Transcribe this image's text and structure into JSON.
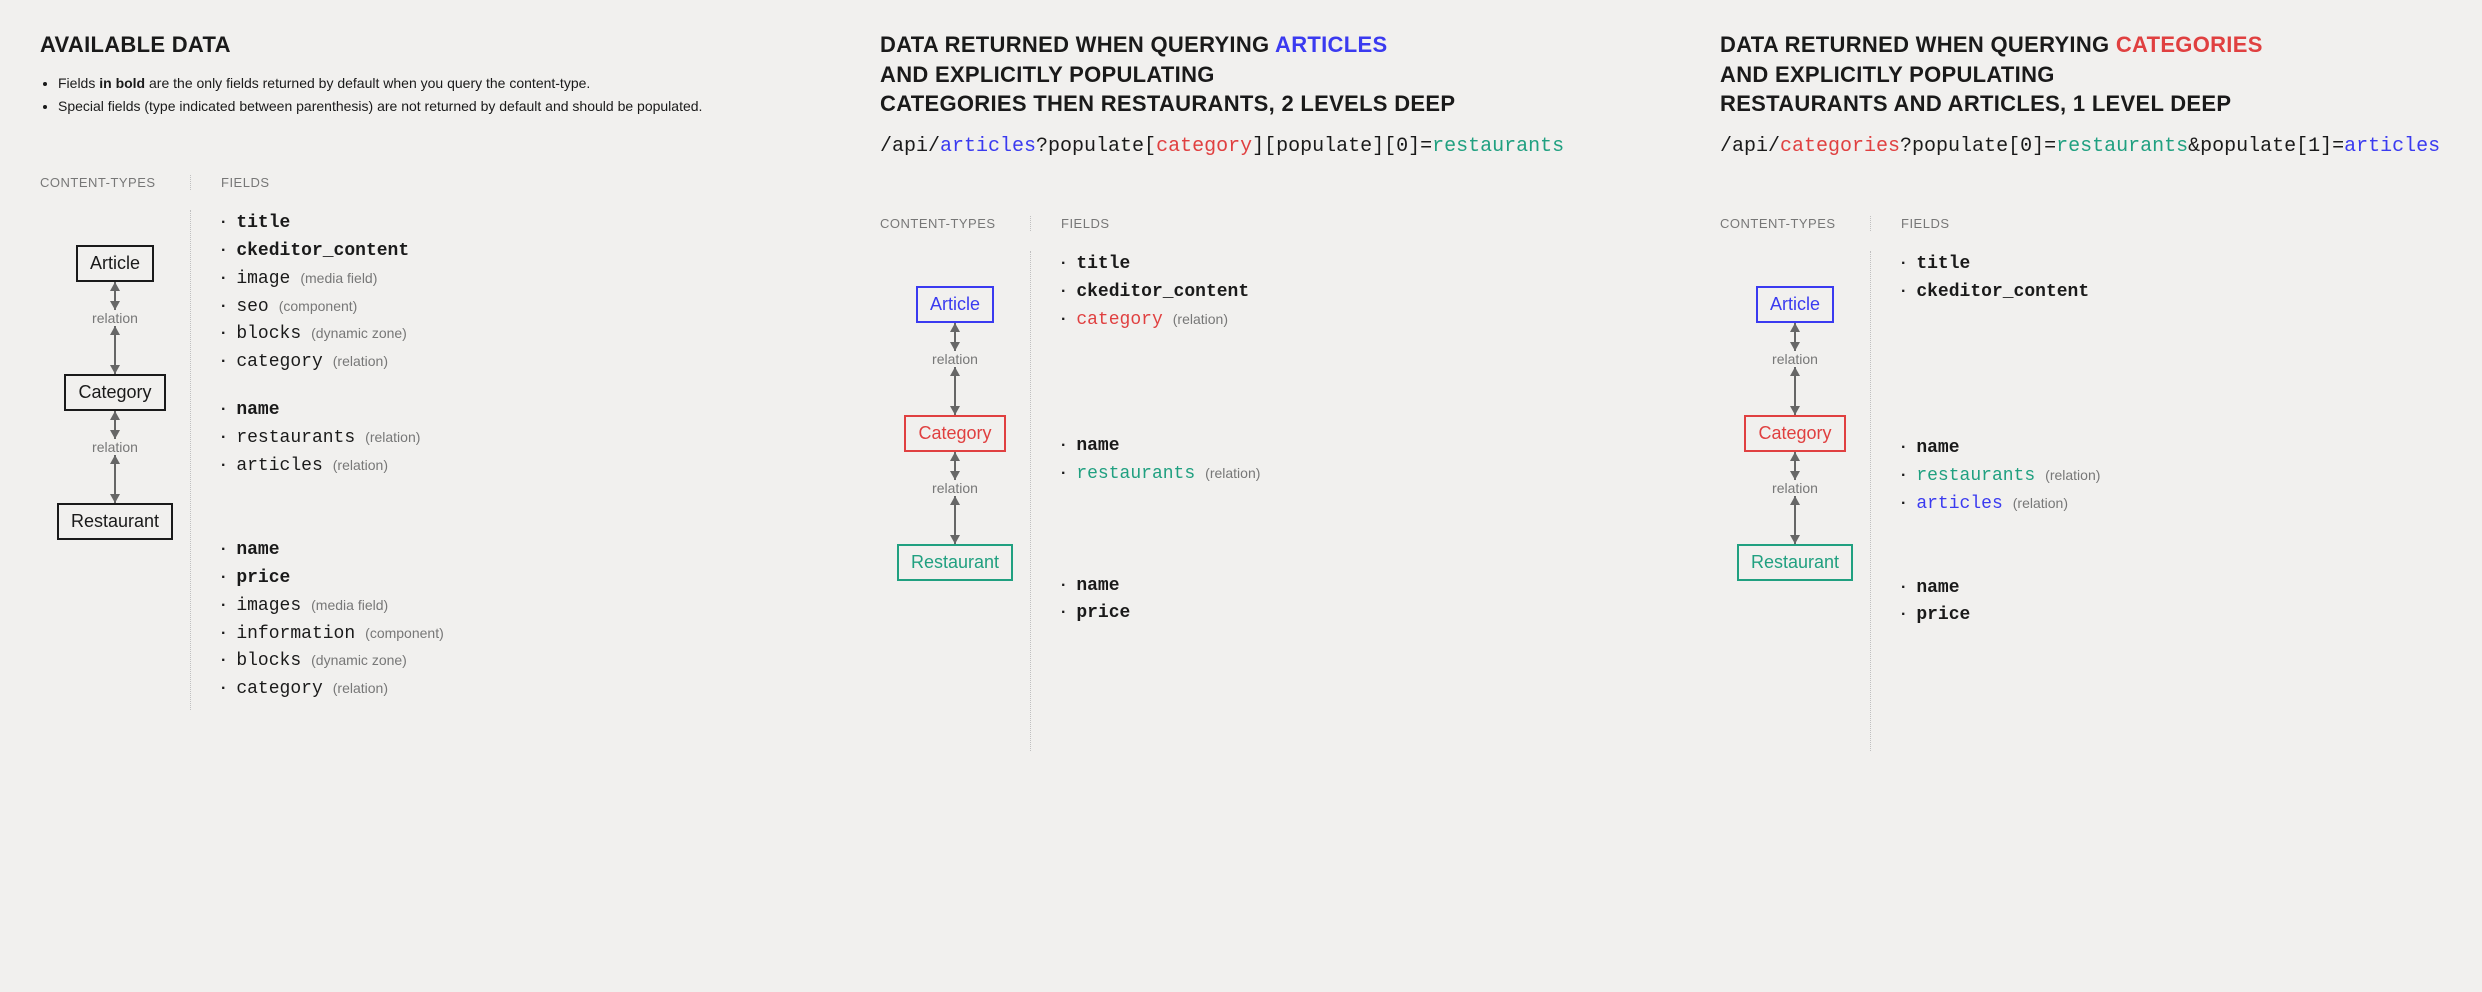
{
  "col1": {
    "title": "AVAILABLE DATA",
    "desc_part1": "Fields ",
    "desc_bold": "in bold",
    "desc_part2": " are the only fields returned by default when you query the content-type.",
    "desc_line2": "Special fields (type indicated between parenthesis) are not returned by default and should be populated.",
    "head_left": "CONTENT-TYPES",
    "head_right": "FIELDS",
    "box_article": "Article",
    "box_category": "Category",
    "box_restaurant": "Restaurant",
    "relation_label": "relation",
    "article_fields": {
      "title": "title",
      "cke": "ckeditor_content",
      "image": "image",
      "image_type": "(media field)",
      "seo": "seo",
      "seo_type": "(component)",
      "blocks": "blocks",
      "blocks_type": "(dynamic zone)",
      "category": "category",
      "category_type": "(relation)"
    },
    "category_fields": {
      "name": "name",
      "restaurants": "restaurants",
      "restaurants_type": "(relation)",
      "articles": "articles",
      "articles_type": "(relation)"
    },
    "restaurant_fields": {
      "name": "name",
      "price": "price",
      "images": "images",
      "images_type": "(media field)",
      "information": "information",
      "information_type": "(component)",
      "blocks": "blocks",
      "blocks_type": "(dynamic zone)",
      "category": "category",
      "category_type": "(relation)"
    }
  },
  "col2": {
    "title_pre": "DATA RETURNED WHEN QUERYING ",
    "title_hi": "ARTICLES",
    "title_line2": "AND EXPLICITLY POPULATING",
    "title_line3": "CATEGORIES THEN RESTAURANTS, 2 LEVELS DEEP",
    "api_p1": "/api/",
    "api_p2": "articles",
    "api_p3": "?populate[",
    "api_p4": "category",
    "api_p5": "][populate][0]=",
    "api_p6": "restaurants",
    "head_left": "CONTENT-TYPES",
    "head_right": "FIELDS",
    "box_article": "Article",
    "box_category": "Category",
    "box_restaurant": "Restaurant",
    "relation_label": "relation",
    "article_fields": {
      "title": "title",
      "cke": "ckeditor_content",
      "category": "category",
      "category_type": "(relation)"
    },
    "category_fields": {
      "name": "name",
      "restaurants": "restaurants",
      "restaurants_type": "(relation)"
    },
    "restaurant_fields": {
      "name": "name",
      "price": "price"
    }
  },
  "col3": {
    "title_pre": "DATA RETURNED WHEN QUERYING ",
    "title_hi": "CATEGORIES",
    "title_line2": "AND EXPLICITLY POPULATING",
    "title_line3": "RESTAURANTS AND ARTICLES, 1 LEVEL DEEP",
    "api_p1": "/api/",
    "api_p2": "categories",
    "api_p3": "?populate[0]=",
    "api_p4": "restaurants",
    "api_p5": "&populate[1]=",
    "api_p6": "articles",
    "head_left": "CONTENT-TYPES",
    "head_right": "FIELDS",
    "box_article": "Article",
    "box_category": "Category",
    "box_restaurant": "Restaurant",
    "relation_label": "relation",
    "article_fields": {
      "title": "title",
      "cke": "ckeditor_content"
    },
    "category_fields": {
      "name": "name",
      "restaurants": "restaurants",
      "restaurants_type": "(relation)",
      "articles": "articles",
      "articles_type": "(relation)"
    },
    "restaurant_fields": {
      "name": "name",
      "price": "price"
    }
  }
}
